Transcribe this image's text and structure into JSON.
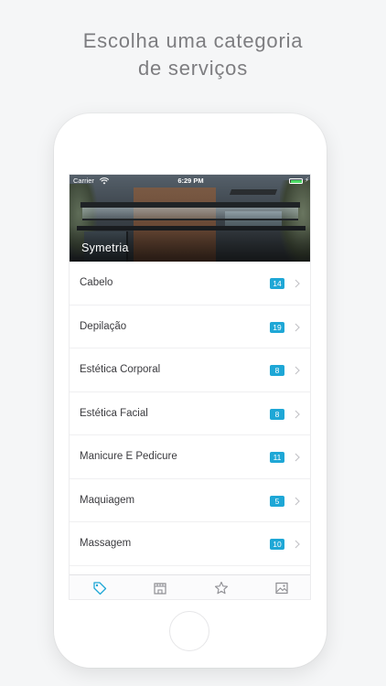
{
  "headline": {
    "line1": "Escolha uma categoria",
    "line2": "de serviços"
  },
  "status_bar": {
    "carrier": "Carrier",
    "time": "6:29 PM",
    "bolt": "⚡"
  },
  "salon": {
    "name": "Symetria"
  },
  "categories": [
    {
      "label": "Cabelo",
      "count": "14"
    },
    {
      "label": "Depilação",
      "count": "19"
    },
    {
      "label": "Estética Corporal",
      "count": "8"
    },
    {
      "label": "Estética Facial",
      "count": "8"
    },
    {
      "label": "Manicure E Pedicure",
      "count": "11"
    },
    {
      "label": "Maquiagem",
      "count": "5"
    },
    {
      "label": "Massagem",
      "count": "10"
    }
  ],
  "tabs": [
    {
      "icon": "tag-icon",
      "active": true
    },
    {
      "icon": "store-icon",
      "active": false
    },
    {
      "icon": "star-icon",
      "active": false
    },
    {
      "icon": "gallery-icon",
      "active": false
    }
  ],
  "colors": {
    "accent": "#1ea7d6",
    "tab_inactive": "#8e8e93",
    "headline": "#7d7d80"
  }
}
